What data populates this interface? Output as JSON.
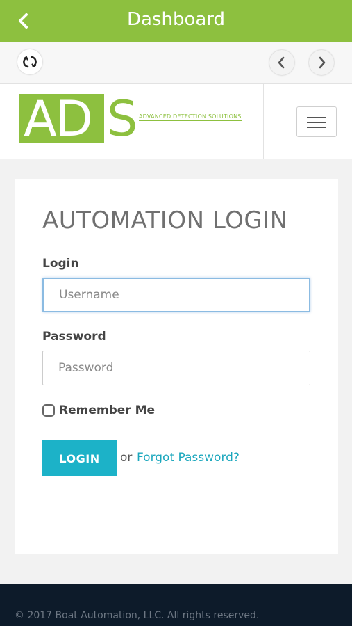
{
  "titlebar": {
    "title": "Dashboard",
    "back_icon": "chevron-left-icon"
  },
  "navrow": {
    "refresh_icon": "refresh-icon",
    "prev_icon": "chevron-left-icon",
    "next_icon": "chevron-right-icon"
  },
  "header": {
    "logo_letters_ad": "AD",
    "logo_letter_s": "S",
    "logo_tagline": "ADVANCED DETECTION SOLUTIONS",
    "menu_icon": "hamburger-menu-icon"
  },
  "login": {
    "heading": "AUTOMATION LOGIN",
    "username_label": "Login",
    "username_placeholder": "Username",
    "username_value": "",
    "password_label": "Password",
    "password_placeholder": "Password",
    "password_value": "",
    "remember_label": "Remember Me",
    "remember_checked": false,
    "login_button": "LOGIN",
    "or_text": "or",
    "forgot_link": "Forgot Password?"
  },
  "footer": {
    "copyright": "© 2017 Boat Automation, LLC. All rights reserved."
  },
  "colors": {
    "brand_green": "#8dc03f",
    "accent_teal": "#1cb2c8",
    "footer_navy": "#0d1b2a"
  }
}
